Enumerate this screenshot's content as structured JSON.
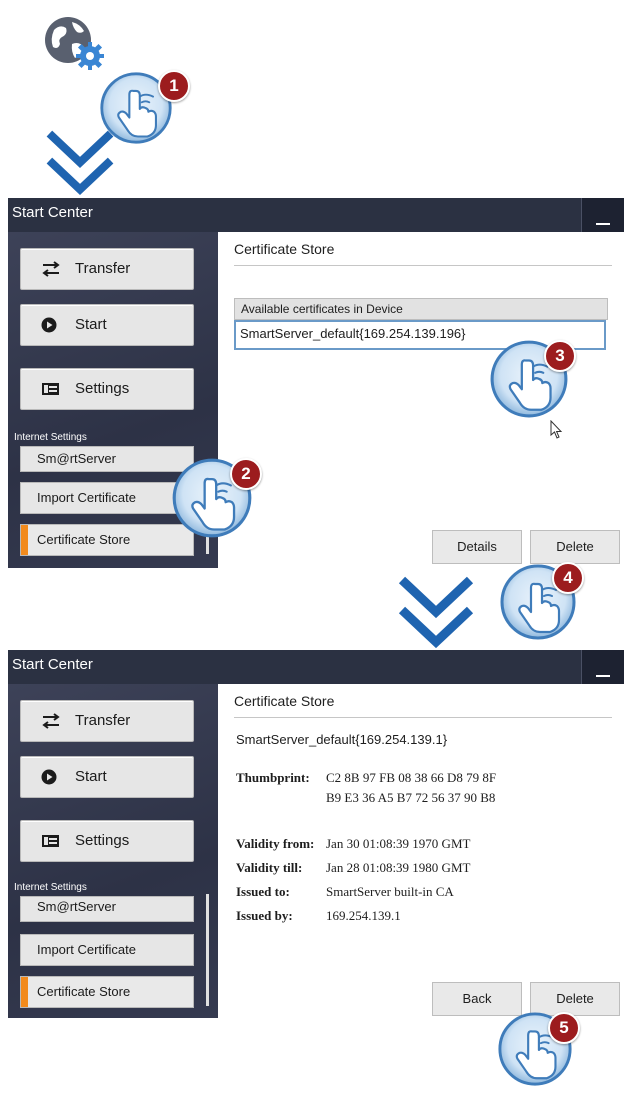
{
  "steps": [
    "1",
    "2",
    "3",
    "4",
    "5"
  ],
  "colors": {
    "titlebar": "#2b3142",
    "accent": "#f28a1c",
    "badge": "#9c1c1e",
    "arrow": "#1f64b0",
    "selection": "#6a9ac8"
  },
  "icons": {
    "settings_app": "globe-gear-icon",
    "transfer": "transfer-arrows-icon",
    "start": "play-circle-icon",
    "settings": "settings-panel-icon",
    "minimize": "minimize-icon",
    "cursor": "mouse-pointer-icon",
    "touch": "touch-hand-icon"
  },
  "screen1": {
    "title": "Start Center",
    "sidebar": {
      "transfer": "Transfer",
      "start": "Start",
      "settings": "Settings",
      "section": "Internet Settings",
      "items": [
        "Sm@rtServer",
        "Import Certificate",
        "Certificate Store"
      ]
    },
    "content": {
      "title": "Certificate Store",
      "list_header": "Available certificates in Device",
      "list_item": "SmartServer_default{169.254.139.196}",
      "details": "Details",
      "delete": "Delete"
    }
  },
  "screen2": {
    "title": "Start Center",
    "sidebar": {
      "transfer": "Transfer",
      "start": "Start",
      "settings": "Settings",
      "section": "Internet Settings",
      "items": [
        "Sm@rtServer",
        "Import Certificate",
        "Certificate Store"
      ]
    },
    "content": {
      "title": "Certificate Store",
      "cert_name": "SmartServer_default{169.254.139.1}",
      "thumbprint_label": "Thumbprint:",
      "thumbprint_1": "C2 8B 97 FB 08 38 66 D8 79 8F",
      "thumbprint_2": "B9 E3 36 A5 B7 72 56 37 90 B8",
      "validity_from_label": "Validity from:",
      "validity_from": "Jan 30 01:08:39 1970 GMT",
      "validity_till_label": "Validity till:",
      "validity_till": "Jan 28 01:08:39 1980 GMT",
      "issued_to_label": "Issued to:",
      "issued_to": "SmartServer built-in CA",
      "issued_by_label": "Issued by:",
      "issued_by": "169.254.139.1",
      "back": "Back",
      "delete": "Delete"
    }
  }
}
